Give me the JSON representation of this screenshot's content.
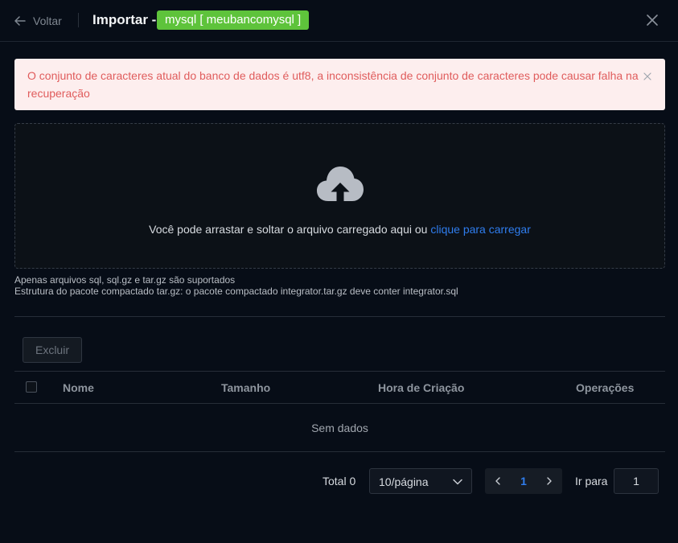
{
  "header": {
    "back_label": "Voltar",
    "title": "Importar -",
    "db_tag": "mysql [ meubancomysql ]"
  },
  "alert": {
    "message": "O conjunto de caracteres atual do banco de dados é utf8, a inconsistência de conjunto de caracteres pode causar falha na recuperação"
  },
  "upload": {
    "text": "Você pode arrastar e soltar o arquivo carregado aqui ou ",
    "link": "clique para carregar",
    "hint1": "Apenas arquivos sql, sql.gz e tar.gz são suportados",
    "hint2": "Estrutura do pacote compactado tar.gz: o pacote compactado integrator.tar.gz deve conter integrator.sql"
  },
  "toolbar": {
    "delete_label": "Excluir"
  },
  "table": {
    "columns": [
      "Nome",
      "Tamanho",
      "Hora de Criação",
      "Operações"
    ],
    "empty_text": "Sem dados"
  },
  "pagination": {
    "total_label": "Total 0",
    "page_size": "10/página",
    "current_page": "1",
    "goto_label": "Ir para",
    "goto_value": "1"
  },
  "colors": {
    "background": "#070d17",
    "tag": "#5ec33b",
    "link": "#2f7dee",
    "alert_bg": "#fdeeee",
    "alert_text": "#e05c5c"
  },
  "icons": [
    "arrow-left-icon",
    "close-icon",
    "cloud-upload-icon",
    "chevron-down-icon",
    "chevron-left-icon",
    "chevron-right-icon"
  ]
}
